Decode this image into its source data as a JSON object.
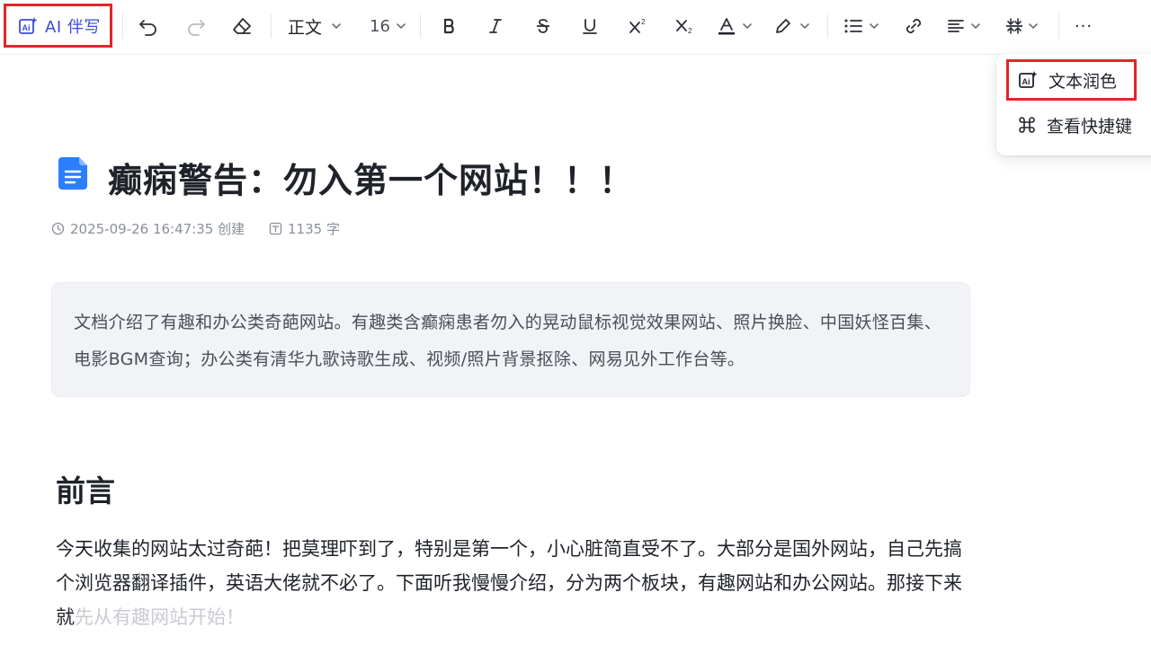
{
  "toolbar": {
    "ai_label": "AI 伴写",
    "text_style": "正文",
    "font_size": "16",
    "more": "···"
  },
  "menu": {
    "polish": "文本润色",
    "shortcuts": "查看快捷键"
  },
  "document": {
    "title": "癫痫警告：勿入第一个网站！！！",
    "created": "2025-09-26 16:47:35 创建",
    "word_count": "1135 字",
    "summary": "文档介绍了有趣和办公类奇葩网站。有趣类含癫痫患者勿入的晃动鼠标视觉效果网站、照片换脸、中国妖怪百集、电影BGM查询；办公类有清华九歌诗歌生成、视频/照片背景抠除、网易见外工作台等。",
    "heading": "前言",
    "paragraph": "今天收集的网站太过奇葩！把莫理吓到了，特别是第一个，小心脏简直受不了。大部分是国外网站，自己先搞个浏览器翻译插件，英语大佬就不必了。下面听我慢慢介绍，分为两个板块，有趣网站和办公网站。那接下来就",
    "paragraph_faded": "先从有趣网站开始！"
  },
  "colors": {
    "accent": "#3c4bd7",
    "highlight_border": "#e0262a",
    "doc_icon": "#2b7fff"
  }
}
